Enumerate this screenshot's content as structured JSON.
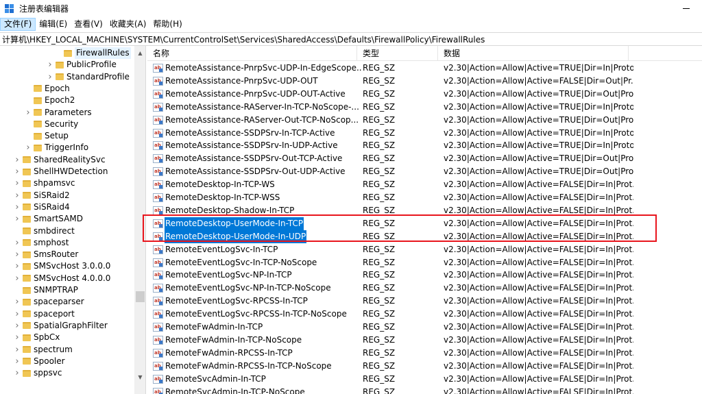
{
  "window": {
    "title": "注册表编辑器"
  },
  "menu": [
    "文件(F)",
    "编辑(E)",
    "查看(V)",
    "收藏夹(A)",
    "帮助(H)"
  ],
  "address": "计算机\\HKEY_LOCAL_MACHINE\\SYSTEM\\CurrentControlSet\\Services\\SharedAccess\\Defaults\\FirewallPolicy\\FirewallRules",
  "tree": {
    "items": [
      {
        "label": "FirewallRules",
        "expander": "none",
        "selected": true
      },
      {
        "label": "PublicProfile",
        "expander": "collapsed"
      },
      {
        "label": "StandardProfile",
        "expander": "collapsed"
      },
      {
        "label": "Epoch",
        "expander": "none"
      },
      {
        "label": "Epoch2",
        "expander": "none"
      },
      {
        "label": "Parameters",
        "expander": "collapsed"
      },
      {
        "label": "Security",
        "expander": "none"
      },
      {
        "label": "Setup",
        "expander": "none"
      },
      {
        "label": "TriggerInfo",
        "expander": "collapsed"
      },
      {
        "label": "SharedRealitySvc",
        "expander": "collapsed"
      },
      {
        "label": "ShellHWDetection",
        "expander": "collapsed"
      },
      {
        "label": "shpamsvc",
        "expander": "collapsed"
      },
      {
        "label": "SiSRaid2",
        "expander": "collapsed"
      },
      {
        "label": "SiSRaid4",
        "expander": "collapsed"
      },
      {
        "label": "SmartSAMD",
        "expander": "collapsed"
      },
      {
        "label": "smbdirect",
        "expander": "none"
      },
      {
        "label": "smphost",
        "expander": "collapsed"
      },
      {
        "label": "SmsRouter",
        "expander": "collapsed"
      },
      {
        "label": "SMSvcHost 3.0.0.0",
        "expander": "collapsed"
      },
      {
        "label": "SMSvcHost 4.0.0.0",
        "expander": "collapsed"
      },
      {
        "label": "SNMPTRAP",
        "expander": "none"
      },
      {
        "label": "spaceparser",
        "expander": "collapsed"
      },
      {
        "label": "spaceport",
        "expander": "collapsed"
      },
      {
        "label": "SpatialGraphFilter",
        "expander": "collapsed"
      },
      {
        "label": "SpbCx",
        "expander": "collapsed"
      },
      {
        "label": "spectrum",
        "expander": "collapsed"
      },
      {
        "label": "Spooler",
        "expander": "collapsed"
      },
      {
        "label": "sppsvc",
        "expander": "collapsed"
      }
    ],
    "scroll_up": "▲",
    "scroll_down": "▼"
  },
  "list": {
    "columns": [
      "名称",
      "类型",
      "数据"
    ],
    "rows": [
      {
        "name": "RemoteAssistance-PnrpSvc-UDP-In-EdgeScope...",
        "type": "REG_SZ",
        "data": "v2.30|Action=Allow|Active=TRUE|Dir=In|Proto..."
      },
      {
        "name": "RemoteAssistance-PnrpSvc-UDP-OUT",
        "type": "REG_SZ",
        "data": "v2.30|Action=Allow|Active=FALSE|Dir=Out|Pr..."
      },
      {
        "name": "RemoteAssistance-PnrpSvc-UDP-OUT-Active",
        "type": "REG_SZ",
        "data": "v2.30|Action=Allow|Active=TRUE|Dir=Out|Pro..."
      },
      {
        "name": "RemoteAssistance-RAServer-In-TCP-NoScope-...",
        "type": "REG_SZ",
        "data": "v2.30|Action=Allow|Active=TRUE|Dir=In|Proto..."
      },
      {
        "name": "RemoteAssistance-RAServer-Out-TCP-NoScop...",
        "type": "REG_SZ",
        "data": "v2.30|Action=Allow|Active=TRUE|Dir=Out|Pro..."
      },
      {
        "name": "RemoteAssistance-SSDPSrv-In-TCP-Active",
        "type": "REG_SZ",
        "data": "v2.30|Action=Allow|Active=TRUE|Dir=In|Proto..."
      },
      {
        "name": "RemoteAssistance-SSDPSrv-In-UDP-Active",
        "type": "REG_SZ",
        "data": "v2.30|Action=Allow|Active=TRUE|Dir=In|Proto..."
      },
      {
        "name": "RemoteAssistance-SSDPSrv-Out-TCP-Active",
        "type": "REG_SZ",
        "data": "v2.30|Action=Allow|Active=TRUE|Dir=Out|Pro..."
      },
      {
        "name": "RemoteAssistance-SSDPSrv-Out-UDP-Active",
        "type": "REG_SZ",
        "data": "v2.30|Action=Allow|Active=TRUE|Dir=Out|Pro..."
      },
      {
        "name": "RemoteDesktop-In-TCP-WS",
        "type": "REG_SZ",
        "data": "v2.30|Action=Allow|Active=FALSE|Dir=In|Prot..."
      },
      {
        "name": "RemoteDesktop-In-TCP-WSS",
        "type": "REG_SZ",
        "data": "v2.30|Action=Allow|Active=FALSE|Dir=In|Prot..."
      },
      {
        "name": "RemoteDesktop-Shadow-In-TCP",
        "type": "REG_SZ",
        "data": "v2.30|Action=Allow|Active=FALSE|Dir=In|Prot..."
      },
      {
        "name": "RemoteDesktop-UserMode-In-TCP",
        "type": "REG_SZ",
        "data": "v2.30|Action=Allow|Active=FALSE|Dir=In|Prot...",
        "selected": true
      },
      {
        "name": "RemoteDesktop-UserMode-In-UDP",
        "type": "REG_SZ",
        "data": "v2.30|Action=Allow|Active=FALSE|Dir=In|Prot...",
        "selected": true
      },
      {
        "name": "RemoteEventLogSvc-In-TCP",
        "type": "REG_SZ",
        "data": "v2.30|Action=Allow|Active=FALSE|Dir=In|Prot..."
      },
      {
        "name": "RemoteEventLogSvc-In-TCP-NoScope",
        "type": "REG_SZ",
        "data": "v2.30|Action=Allow|Active=FALSE|Dir=In|Prot..."
      },
      {
        "name": "RemoteEventLogSvc-NP-In-TCP",
        "type": "REG_SZ",
        "data": "v2.30|Action=Allow|Active=FALSE|Dir=In|Prot..."
      },
      {
        "name": "RemoteEventLogSvc-NP-In-TCP-NoScope",
        "type": "REG_SZ",
        "data": "v2.30|Action=Allow|Active=FALSE|Dir=In|Prot..."
      },
      {
        "name": "RemoteEventLogSvc-RPCSS-In-TCP",
        "type": "REG_SZ",
        "data": "v2.30|Action=Allow|Active=FALSE|Dir=In|Prot..."
      },
      {
        "name": "RemoteEventLogSvc-RPCSS-In-TCP-NoScope",
        "type": "REG_SZ",
        "data": "v2.30|Action=Allow|Active=FALSE|Dir=In|Prot..."
      },
      {
        "name": "RemoteFwAdmin-In-TCP",
        "type": "REG_SZ",
        "data": "v2.30|Action=Allow|Active=FALSE|Dir=In|Prot..."
      },
      {
        "name": "RemoteFwAdmin-In-TCP-NoScope",
        "type": "REG_SZ",
        "data": "v2.30|Action=Allow|Active=FALSE|Dir=In|Prot..."
      },
      {
        "name": "RemoteFwAdmin-RPCSS-In-TCP",
        "type": "REG_SZ",
        "data": "v2.30|Action=Allow|Active=FALSE|Dir=In|Prot..."
      },
      {
        "name": "RemoteFwAdmin-RPCSS-In-TCP-NoScope",
        "type": "REG_SZ",
        "data": "v2.30|Action=Allow|Active=FALSE|Dir=In|Prot..."
      },
      {
        "name": "RemoteSvcAdmin-In-TCP",
        "type": "REG_SZ",
        "data": "v2.30|Action=Allow|Active=FALSE|Dir=In|Prot..."
      },
      {
        "name": "RemoteSvcAdmin-In-TCP-NoScope",
        "type": "REG_SZ",
        "data": "v2.30|Action=Allow|Active=FALSE|Dir=In|Prot..."
      }
    ]
  },
  "colors": {
    "selection": "#0078d7",
    "annotation_box": "#e8141c",
    "folder": "#f0c654"
  }
}
